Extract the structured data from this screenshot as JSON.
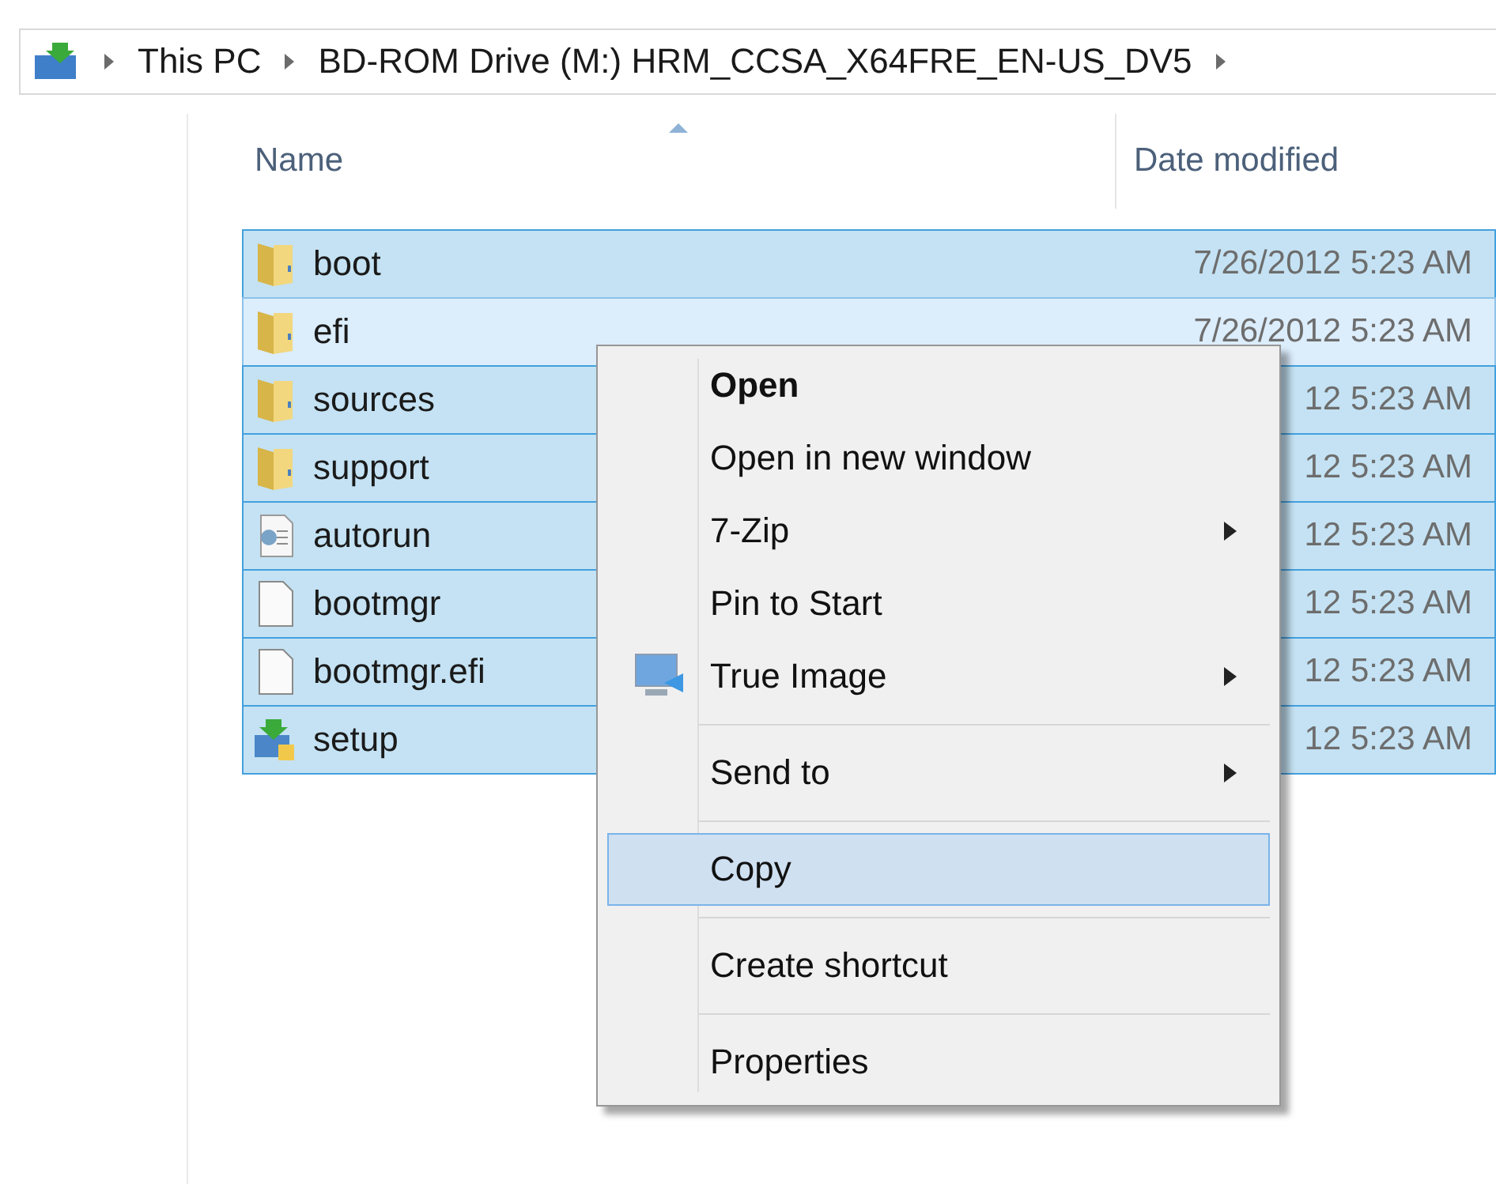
{
  "address_bar": {
    "crumbs": [
      "This PC",
      "BD-ROM Drive (M:) HRM_CCSA_X64FRE_EN-US_DV5"
    ]
  },
  "columns": [
    {
      "label": "Name",
      "sorted": true
    },
    {
      "label": "Date modified",
      "sorted": false
    }
  ],
  "files": [
    {
      "name": "boot",
      "kind": "folder",
      "date": "7/26/2012 5:23 AM",
      "selected": true,
      "hovered": false
    },
    {
      "name": "efi",
      "kind": "folder",
      "date": "7/26/2012 5:23 AM",
      "selected": true,
      "hovered": true
    },
    {
      "name": "sources",
      "kind": "folder",
      "date": "12 5:23 AM",
      "selected": true,
      "hovered": false
    },
    {
      "name": "support",
      "kind": "folder",
      "date": "12 5:23 AM",
      "selected": true,
      "hovered": false
    },
    {
      "name": "autorun",
      "kind": "config",
      "date": "12 5:23 AM",
      "selected": true,
      "hovered": false
    },
    {
      "name": "bootmgr",
      "kind": "file",
      "date": "12 5:23 AM",
      "selected": true,
      "hovered": false
    },
    {
      "name": "bootmgr.efi",
      "kind": "file",
      "date": "12 5:23 AM",
      "selected": true,
      "hovered": false
    },
    {
      "name": "setup",
      "kind": "setup",
      "date": "12 5:23 AM",
      "selected": true,
      "hovered": false
    }
  ],
  "context_menu": {
    "groups": [
      [
        {
          "label": "Open",
          "default": true,
          "submenu": false,
          "icon": false,
          "selected": false
        },
        {
          "label": "Open in new window",
          "default": false,
          "submenu": false,
          "icon": false,
          "selected": false
        },
        {
          "label": "7-Zip",
          "default": false,
          "submenu": true,
          "icon": false,
          "selected": false
        },
        {
          "label": "Pin to Start",
          "default": false,
          "submenu": false,
          "icon": false,
          "selected": false
        },
        {
          "label": "True Image",
          "default": false,
          "submenu": true,
          "icon": true,
          "selected": false
        }
      ],
      [
        {
          "label": "Send to",
          "default": false,
          "submenu": true,
          "icon": false,
          "selected": false
        }
      ],
      [
        {
          "label": "Copy",
          "default": false,
          "submenu": false,
          "icon": false,
          "selected": true
        }
      ],
      [
        {
          "label": "Create shortcut",
          "default": false,
          "submenu": false,
          "icon": false,
          "selected": false
        }
      ],
      [
        {
          "label": "Properties",
          "default": false,
          "submenu": false,
          "icon": false,
          "selected": false
        }
      ]
    ]
  }
}
